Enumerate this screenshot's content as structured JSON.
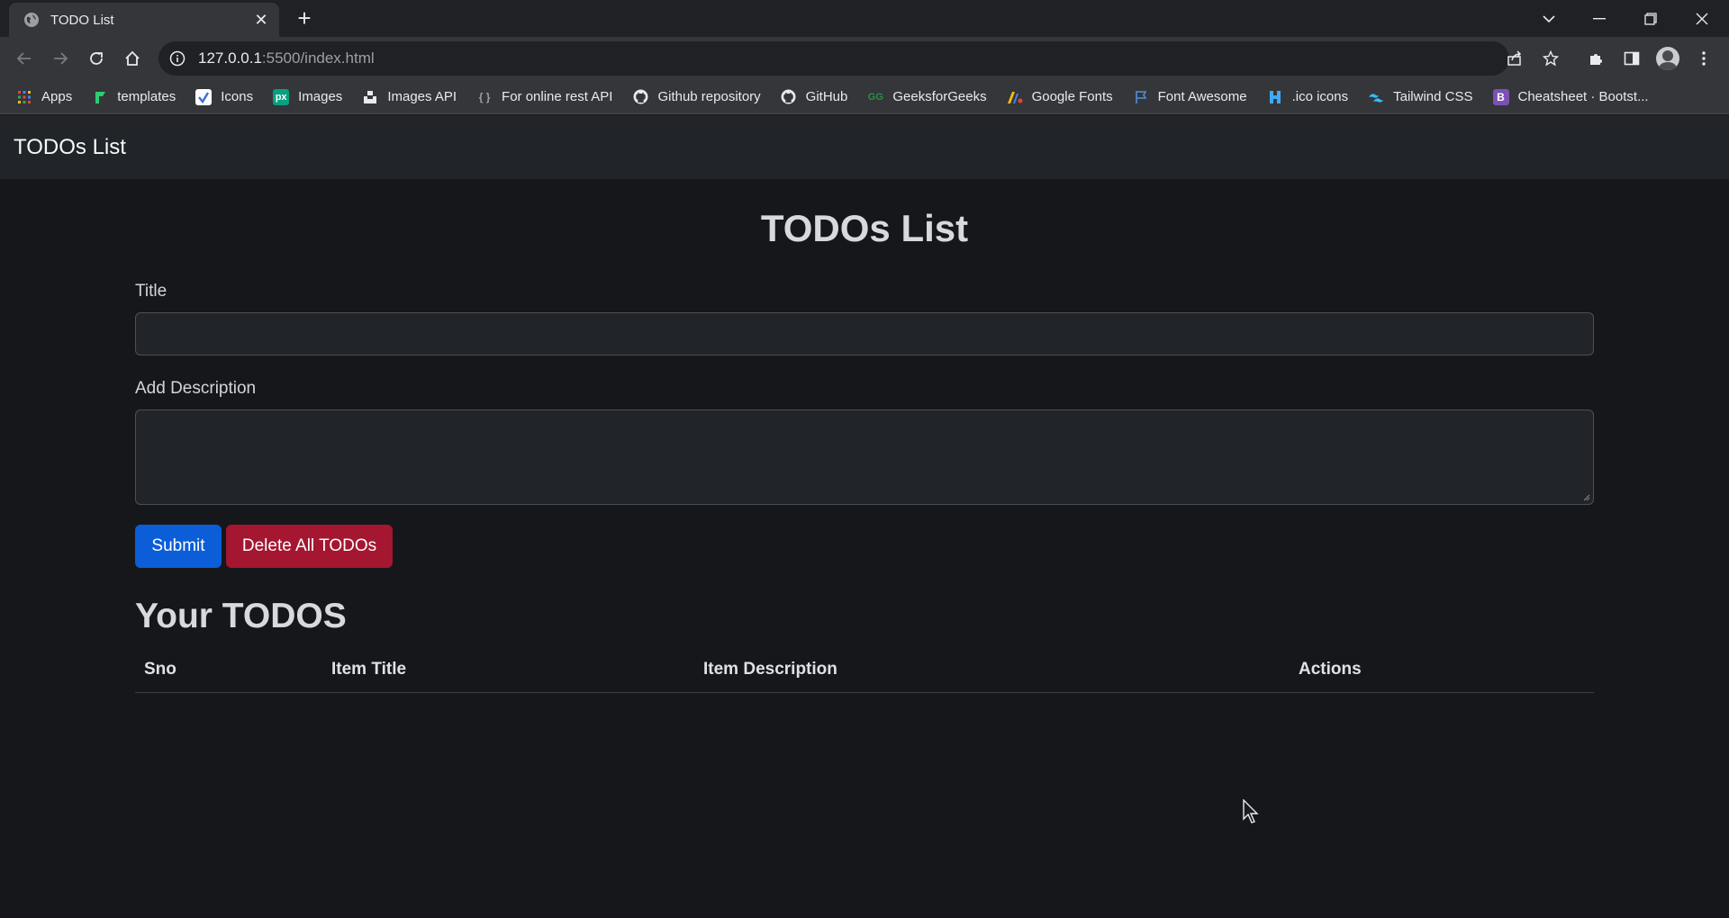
{
  "browser": {
    "tab_title": "TODO List",
    "url_host": "127.0.0.1",
    "url_rest": ":5500/index.html",
    "bookmarks": [
      {
        "label": "Apps",
        "icon": "apps-grid-icon"
      },
      {
        "label": "templates",
        "icon": "templates-icon"
      },
      {
        "label": "Icons",
        "icon": "icons-icon"
      },
      {
        "label": "Images",
        "icon": "px-icon"
      },
      {
        "label": "Images API",
        "icon": "unsplash-icon"
      },
      {
        "label": "For online rest API",
        "icon": "rest-api-icon"
      },
      {
        "label": "Github repository",
        "icon": "github-icon"
      },
      {
        "label": "GitHub",
        "icon": "github-icon"
      },
      {
        "label": "GeeksforGeeks",
        "icon": "gfg-icon"
      },
      {
        "label": "Google Fonts",
        "icon": "google-fonts-icon"
      },
      {
        "label": "Font Awesome",
        "icon": "flag-icon"
      },
      {
        "label": ".ico icons",
        "icon": "ico-icon"
      },
      {
        "label": "Tailwind CSS",
        "icon": "tailwind-icon"
      },
      {
        "label": "Cheatsheet · Bootst...",
        "icon": "bootstrap-icon"
      }
    ]
  },
  "navbar": {
    "brand": "TODOs List"
  },
  "main": {
    "heading": "TODOs List",
    "title_label": "Title",
    "title_value": "",
    "description_label": "Add Description",
    "description_value": "",
    "submit_label": "Submit",
    "delete_all_label": "Delete All TODOs",
    "section_heading": "Your TODOS",
    "table_headers": [
      "Sno",
      "Item Title",
      "Item Description",
      "Actions"
    ]
  },
  "colors": {
    "page_bg": "#16171b",
    "navbar_bg": "#212529",
    "submit": "#0b5ed7",
    "delete": "#a51631"
  }
}
